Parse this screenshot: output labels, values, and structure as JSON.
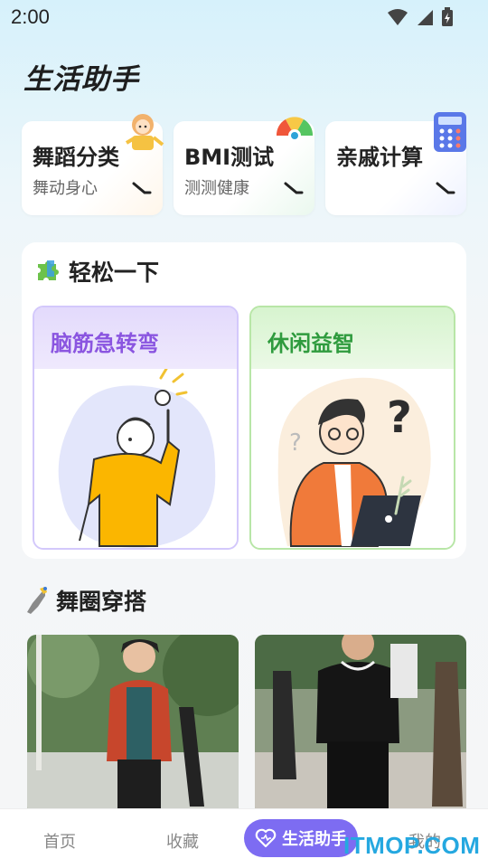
{
  "status_bar": {
    "time": "2:00"
  },
  "page_title": "生活助手",
  "quick_cards": [
    {
      "title": "舞蹈分类",
      "subtitle": "舞动身心",
      "icon": "dancer-doll-icon"
    },
    {
      "title": "BMI测试",
      "subtitle": "测测健康",
      "icon": "gauge-icon"
    },
    {
      "title": "亲戚计算",
      "subtitle": "",
      "icon": "calculator-icon"
    }
  ],
  "relax": {
    "title": "轻松一下",
    "icon": "puzzle-icon",
    "cards": [
      {
        "title": "脑筋急转弯",
        "accent": "#8a55e0"
      },
      {
        "title": "休闲益智",
        "accent": "#2f9b3e"
      }
    ]
  },
  "outfit": {
    "title": "舞圈穿搭",
    "icon": "dancing-shoe-icon"
  },
  "bottom_nav": {
    "items": [
      "首页",
      "收藏",
      "生活助手",
      "我的"
    ],
    "active": "生活助手"
  },
  "watermark": "ITMOP.COM",
  "colors": {
    "accent": "#7d6cf2",
    "brain_card": "#ece6fd",
    "leisure_card": "#e2f7dc"
  }
}
